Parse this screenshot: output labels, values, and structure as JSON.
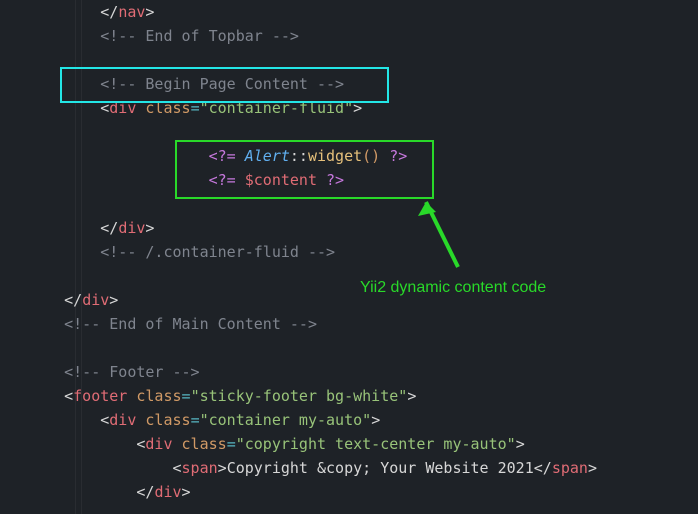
{
  "lines": {
    "l1_close_nav": "</nav>",
    "l2_comment": "<!-- End of Topbar -->",
    "l4_comment": "<!-- Begin Page Content -->",
    "l5_open": "<div class=\"container-fluid\">",
    "l7_php1": "<?= Alert::widget() ?>",
    "l8_php2": "<?= $content ?>",
    "l10_closediv": "</div>",
    "l11_comment": "<!-- /.container-fluid -->",
    "l13_closediv": "</div>",
    "l14_comment": "<!-- End of Main Content -->",
    "l16_comment": "<!-- Footer -->",
    "l17_footer": "<footer class=\"sticky-footer bg-white\">",
    "l18_div": "<div class=\"container my-auto\">",
    "l19_div": "<div class=\"copyright text-center my-auto\">",
    "l20_span": "<span>Copyright &copy; Your Website 2021</span>",
    "l21_closediv": "</div>"
  },
  "annotation": "Yii2 dynamic content code",
  "tokens": {
    "nav": "nav",
    "div": "div",
    "footer": "footer",
    "span": "span",
    "class": "class",
    "container_fluid": "\"container-fluid\"",
    "sticky": "\"sticky-footer bg-white\"",
    "container_my": "\"container my-auto\"",
    "copyright_cls": "\"copyright text-center my-auto\"",
    "end_topbar": "&lt;!-- End of Topbar --&gt;",
    "begin_page": "&lt;!-- Begin Page Content --&gt;",
    "end_container": "&lt;!-- /.container-fluid --&gt;",
    "end_main": "&lt;!-- End of Main Content --&gt;",
    "footer_c": "&lt;!-- Footer --&gt;",
    "php_open": "&lt;?=",
    "php_close": "?&gt;",
    "alert": "Alert",
    "dcolon": "::",
    "widget": "widget",
    "parens": "()",
    "content_var": "$content",
    "copyright_txt": "Copyright &amp;copy; Your Website 2021",
    "amp_copy": "&amp;copy;",
    "copy_pre": "Copyright ",
    "copy_post": " Your Website 2021"
  }
}
